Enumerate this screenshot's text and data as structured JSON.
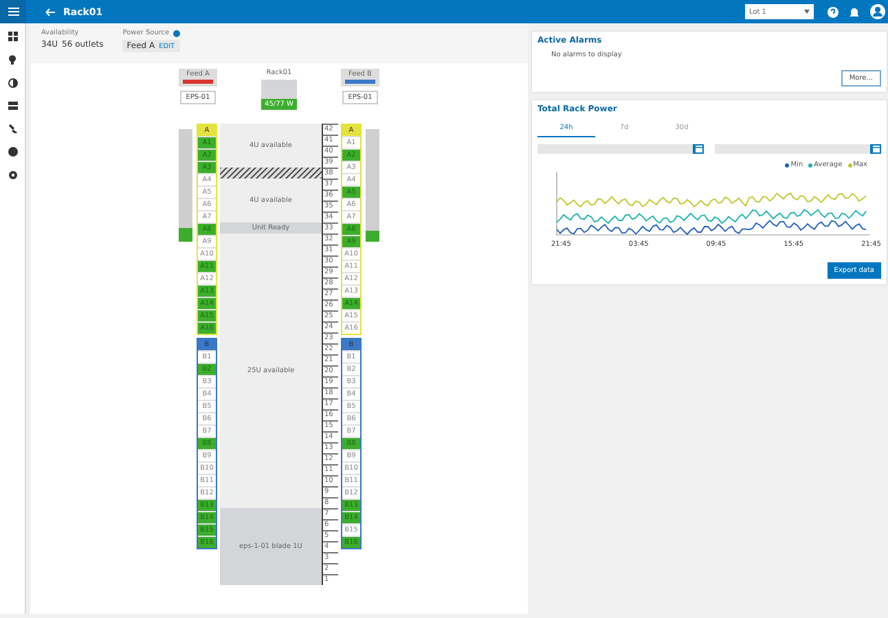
{
  "top_bar": {
    "title": "Rack01",
    "location": "Lot 1"
  },
  "summary": {
    "availability_label": "Availability",
    "units": "34U",
    "outlets": "56 outlets",
    "power_source_label": "Power Source",
    "feed": "Feed A",
    "edit": "EDIT"
  },
  "rack": {
    "name": "Rack01",
    "reading": "45/77 W",
    "slots": [
      {
        "kind": "available",
        "label": "4U available"
      },
      {
        "kind": "blank"
      },
      {
        "kind": "available",
        "label": "4U available"
      },
      {
        "kind": "device",
        "label": "Unit Ready"
      },
      {
        "kind": "available",
        "label": "25U available"
      },
      {
        "kind": "device",
        "label": "eps-1-01 blade 1U"
      }
    ],
    "ruler": [
      "42",
      "41",
      "40",
      "39",
      "38",
      "37",
      "36",
      "35",
      "34",
      "33",
      "32",
      "31",
      "30",
      "29",
      "28",
      "27",
      "26",
      "25",
      "24",
      "23",
      "22",
      "21",
      "20",
      "19",
      "18",
      "17",
      "16",
      "15",
      "14",
      "13",
      "12",
      "11",
      "10",
      "9",
      "8",
      "7",
      "6",
      "5",
      "4",
      "3",
      "2",
      "1"
    ]
  },
  "pdus": [
    {
      "feed": "Feed A",
      "color": "#d9342b",
      "name": "EPS-01",
      "level": 0.12,
      "banks": [
        {
          "label": "A",
          "color": "#e6e23c",
          "outlets": [
            {
              "label": "A1",
              "on": true
            },
            {
              "label": "A2",
              "on": true
            },
            {
              "label": "A3",
              "on": true
            },
            {
              "label": "A4",
              "on": false
            },
            {
              "label": "A5",
              "on": false
            },
            {
              "label": "A6",
              "on": false
            },
            {
              "label": "A7",
              "on": false
            },
            {
              "label": "A8",
              "on": true
            },
            {
              "label": "A9",
              "on": false
            },
            {
              "label": "A10",
              "on": false
            },
            {
              "label": "A11",
              "on": true
            },
            {
              "label": "A12",
              "on": false
            },
            {
              "label": "A13",
              "on": true
            },
            {
              "label": "A14",
              "on": true
            },
            {
              "label": "A15",
              "on": true
            },
            {
              "label": "A16",
              "on": true
            }
          ]
        },
        {
          "label": "B",
          "color": "#3a78c8",
          "outlets": [
            {
              "label": "B1",
              "on": false
            },
            {
              "label": "B2",
              "on": true
            },
            {
              "label": "B3",
              "on": false
            },
            {
              "label": "B4",
              "on": false
            },
            {
              "label": "B5",
              "on": false
            },
            {
              "label": "B6",
              "on": false
            },
            {
              "label": "B7",
              "on": false
            },
            {
              "label": "B8",
              "on": true
            },
            {
              "label": "B9",
              "on": false
            },
            {
              "label": "B10",
              "on": false
            },
            {
              "label": "B11",
              "on": false
            },
            {
              "label": "B12",
              "on": false
            },
            {
              "label": "B13",
              "on": true
            },
            {
              "label": "B14",
              "on": true
            },
            {
              "label": "B15",
              "on": true
            },
            {
              "label": "B16",
              "on": true
            }
          ]
        }
      ]
    },
    {
      "feed": "Feed B",
      "color": "#3a78c8",
      "name": "EPS-01",
      "level": 0.1,
      "banks": [
        {
          "label": "A",
          "color": "#e6e23c",
          "outlets": [
            {
              "label": "A1",
              "on": false
            },
            {
              "label": "A2",
              "on": true
            },
            {
              "label": "A3",
              "on": false
            },
            {
              "label": "A4",
              "on": false
            },
            {
              "label": "A5",
              "on": true
            },
            {
              "label": "A6",
              "on": false
            },
            {
              "label": "A7",
              "on": false
            },
            {
              "label": "A8",
              "on": true
            },
            {
              "label": "A9",
              "on": true
            },
            {
              "label": "A10",
              "on": false
            },
            {
              "label": "A11",
              "on": false
            },
            {
              "label": "A12",
              "on": false
            },
            {
              "label": "A13",
              "on": false
            },
            {
              "label": "A14",
              "on": true
            },
            {
              "label": "A15",
              "on": false
            },
            {
              "label": "A16",
              "on": false
            }
          ]
        },
        {
          "label": "B",
          "color": "#3a78c8",
          "outlets": [
            {
              "label": "B1",
              "on": false
            },
            {
              "label": "B2",
              "on": false
            },
            {
              "label": "B3",
              "on": false
            },
            {
              "label": "B4",
              "on": false
            },
            {
              "label": "B5",
              "on": false
            },
            {
              "label": "B6",
              "on": false
            },
            {
              "label": "B7",
              "on": false
            },
            {
              "label": "B8",
              "on": true
            },
            {
              "label": "B9",
              "on": false
            },
            {
              "label": "B10",
              "on": false
            },
            {
              "label": "B11",
              "on": false
            },
            {
              "label": "B12",
              "on": false
            },
            {
              "label": "B13",
              "on": true
            },
            {
              "label": "B14",
              "on": true
            },
            {
              "label": "B15",
              "on": false
            },
            {
              "label": "B16",
              "on": true
            }
          ]
        }
      ]
    }
  ],
  "alarms": {
    "title": "Active Alarms",
    "empty": "No alarms to display",
    "more": "More..."
  },
  "power": {
    "title": "Total Rack Power",
    "tabs": [
      {
        "label": "24h",
        "selected": true
      },
      {
        "label": "7d",
        "selected": false
      },
      {
        "label": "30d",
        "selected": false
      }
    ],
    "legend": [
      {
        "name": "Min",
        "color": "#1f5fb8"
      },
      {
        "name": "Average",
        "color": "#1bb3b0"
      },
      {
        "name": "Max",
        "color": "#bfc72a"
      }
    ],
    "x_labels": [
      "21:45",
      "03:45",
      "09:45",
      "15:45",
      "21:45"
    ],
    "export": "Export data"
  }
}
